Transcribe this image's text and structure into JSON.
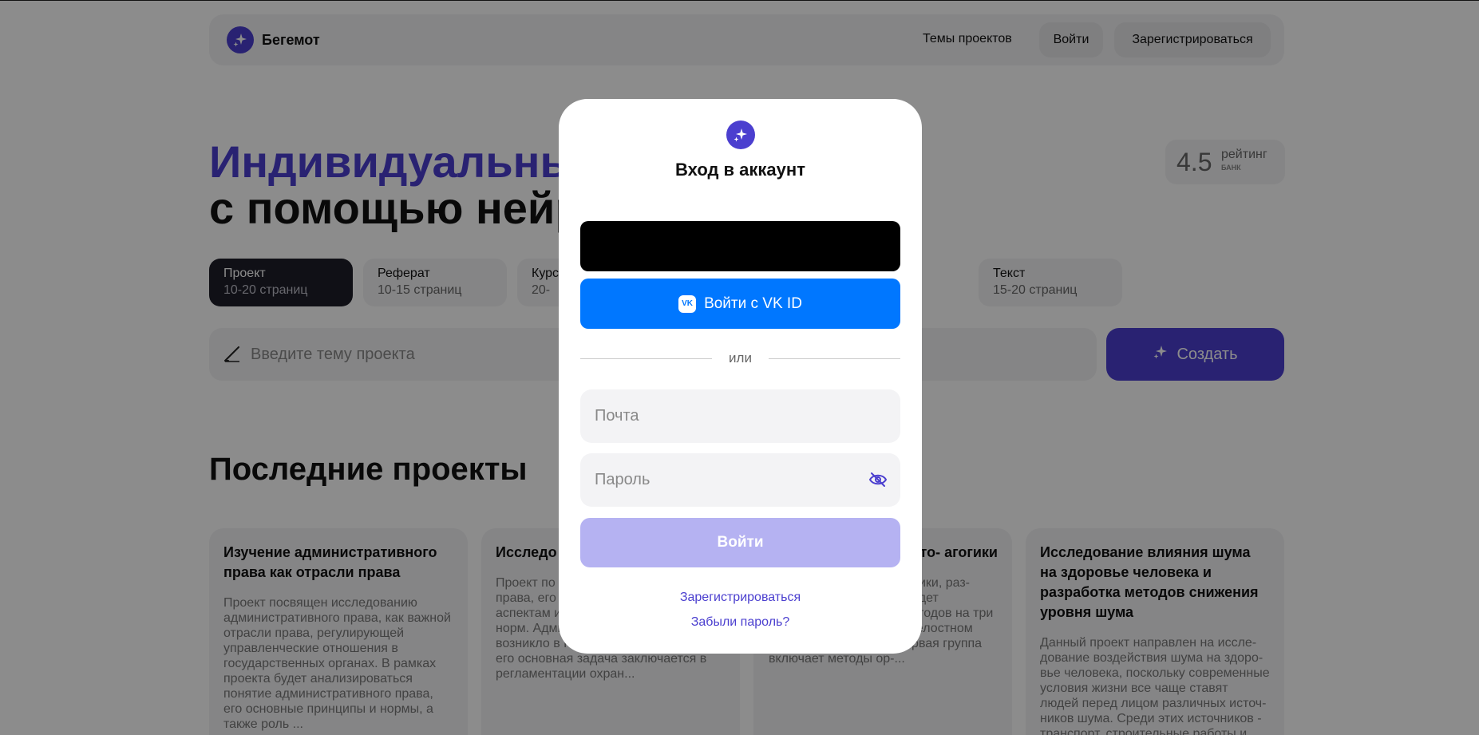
{
  "header": {
    "brand": "Бегемот",
    "nav": {
      "themes": "Темы проектов",
      "login": "Войти",
      "register": "Зарегистрироваться"
    }
  },
  "hero": {
    "line1": "Индивидуальный",
    "line2": "с помощью нейро"
  },
  "rating": {
    "value": "4.5",
    "label": "рейтинг",
    "bank": "БАНК"
  },
  "chips": [
    {
      "title": "Проект",
      "sub": "10-20 страниц"
    },
    {
      "title": "Реферат",
      "sub": "10-15 страниц"
    },
    {
      "title": "Курс",
      "sub": "20-"
    },
    {
      "title": "Текст",
      "sub": "15-20 страниц"
    }
  ],
  "topic": {
    "placeholder": "Введите тему проекта",
    "create": "Создать"
  },
  "recent": {
    "title": "Последние проекты",
    "cards": [
      {
        "title": "Изучение административного права как отрасли права",
        "desc": "Проект посвящен исследованию административного права, как важной отрасли права, регулирующей управленческие отношения в государственных органах. В рамках проекта будет анализироваться понятие административного права, его основные принципы и нормы, а также роль ..."
      },
      {
        "title": "Исследо администр права как",
        "desc": "Проект по стративно ной отрасли права, его формирова­нию, ключевым аспектам и роли в си­стеме правовых норм. Администра­тивное право возникло в России в конце XIX века, и его основная задача заключается в регламентации охран..."
      },
      {
        "title": "ации мето- агогики",
        "desc": "ованию и фикаций ме- огики, раз- ким. В рамках проекта будет рассмотрено деление методов на три группы, основанных на целостном подходе к обучению. Первая группа включает методы ор-..."
      },
      {
        "title": "Исследование влияния шума на здоровье человека и разработка методов снижения уровня шума",
        "desc": "Данный проект направлен на иссле­дование воздействия шума на здоро­вье человека, поскольку современ­ные условия жизни все чаще ставят людей перед лицом различных источ­ников шума. Среди этих источников - транспорт, строительные работы и"
      }
    ]
  },
  "modal": {
    "title": "Вход в аккаунт",
    "vk": "Войти с VK ID",
    "vk_logo": "VK",
    "or": "или",
    "email_placeholder": "Почта",
    "password_placeholder": "Пароль",
    "submit": "Войти",
    "register": "Зарегистрироваться",
    "forgot": "Забыли пароль?"
  },
  "colors": {
    "brand": "#4b3fcf",
    "vk": "#0077ff",
    "submit_disabled": "#b5b2f2"
  }
}
